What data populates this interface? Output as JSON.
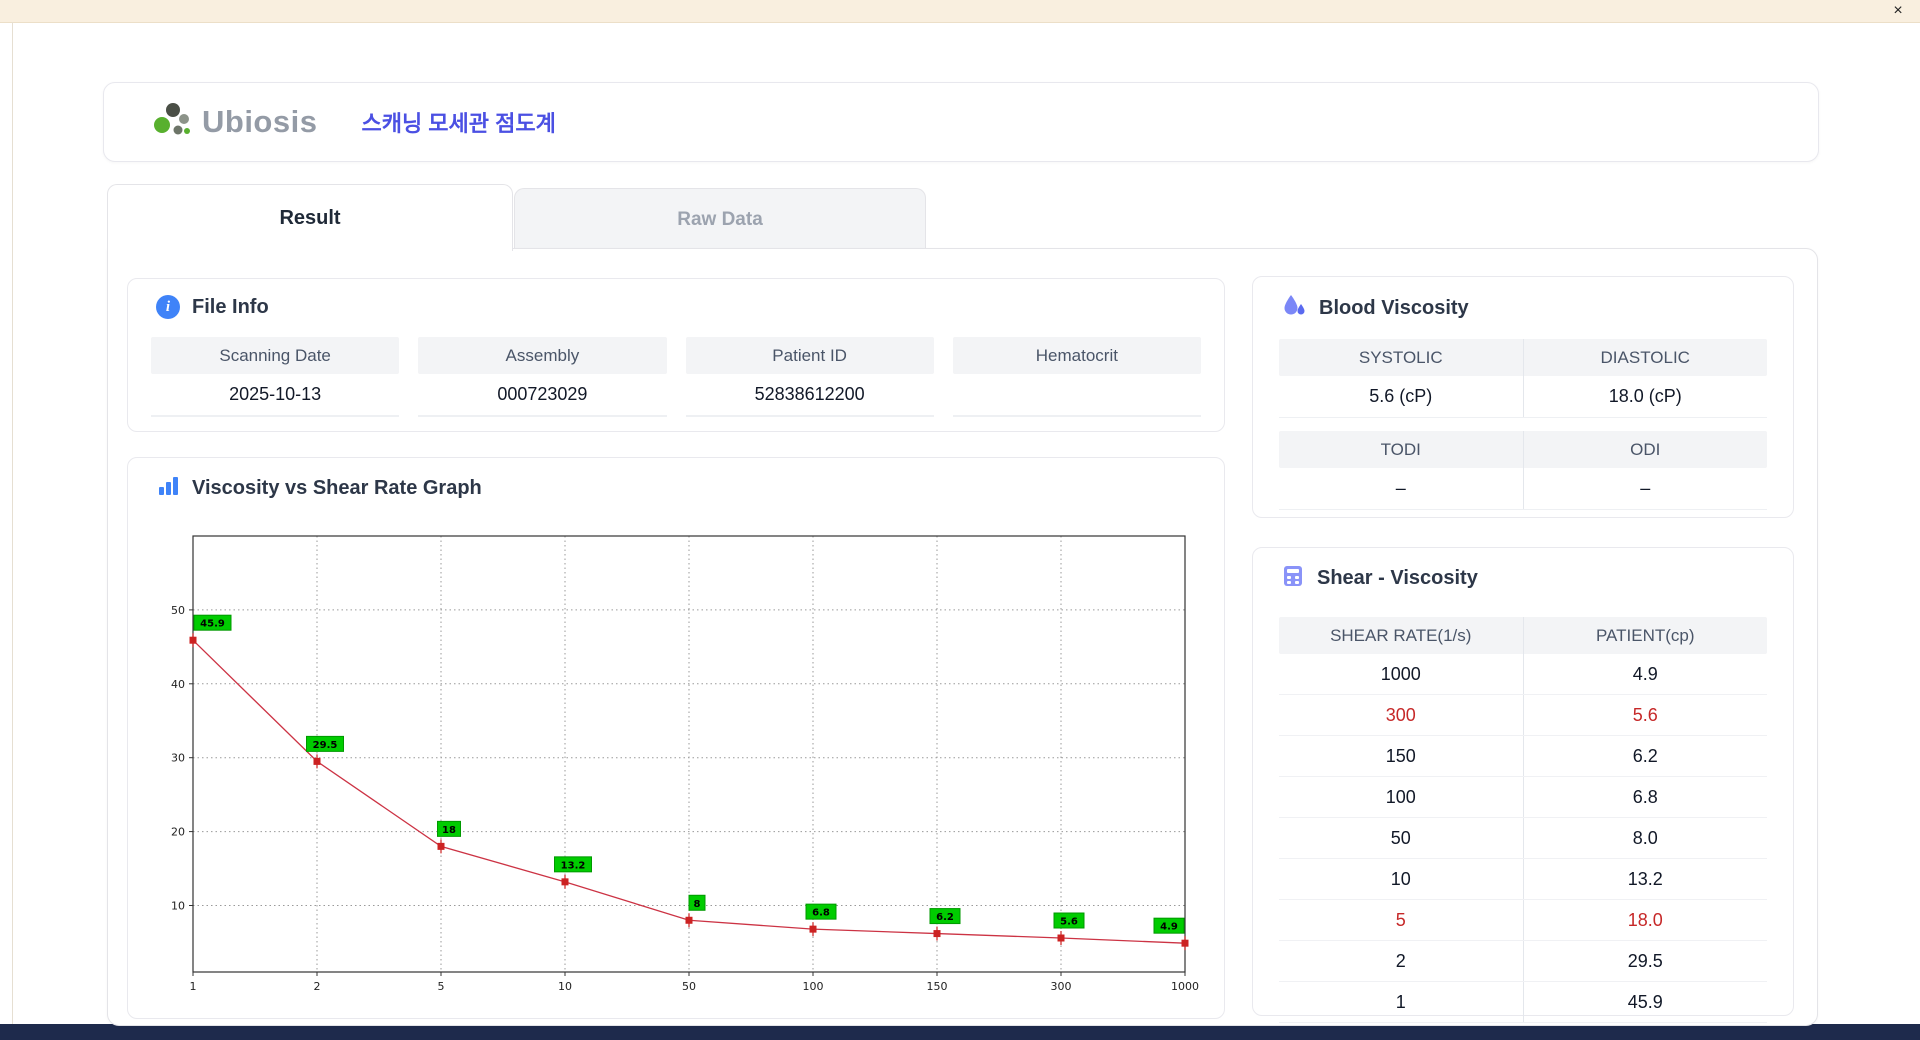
{
  "window": {
    "close_label": "×"
  },
  "header": {
    "logo_text": "Ubiosis",
    "app_title": "스캐닝 모세관 점도계"
  },
  "tabs": [
    {
      "label": "Result",
      "active": true
    },
    {
      "label": "Raw Data",
      "active": false
    }
  ],
  "file_info": {
    "title": "File Info",
    "fields": [
      {
        "label": "Scanning Date",
        "value": "2025-10-13"
      },
      {
        "label": "Assembly",
        "value": "000723029"
      },
      {
        "label": "Patient ID",
        "value": "52838612200"
      },
      {
        "label": "Hematocrit",
        "value": ""
      }
    ]
  },
  "blood_viscosity": {
    "title": "Blood Viscosity",
    "rows": [
      {
        "headers": [
          "SYSTOLIC",
          "DIASTOLIC"
        ],
        "values": [
          "5.6 (cP)",
          "18.0 (cP)"
        ]
      },
      {
        "headers": [
          "TODI",
          "ODI"
        ],
        "values": [
          "–",
          "–"
        ]
      }
    ]
  },
  "shear_viscosity": {
    "title": "Shear - Viscosity",
    "columns": [
      "SHEAR RATE(1/s)",
      "PATIENT(cp)"
    ],
    "rows": [
      {
        "shear": "1000",
        "patient": "4.9",
        "highlight": false
      },
      {
        "shear": "300",
        "patient": "5.6",
        "highlight": true
      },
      {
        "shear": "150",
        "patient": "6.2",
        "highlight": false
      },
      {
        "shear": "100",
        "patient": "6.8",
        "highlight": false
      },
      {
        "shear": "50",
        "patient": "8.0",
        "highlight": false
      },
      {
        "shear": "10",
        "patient": "13.2",
        "highlight": false
      },
      {
        "shear": "5",
        "patient": "18.0",
        "highlight": true
      },
      {
        "shear": "2",
        "patient": "29.5",
        "highlight": false
      },
      {
        "shear": "1",
        "patient": "45.9",
        "highlight": false
      }
    ]
  },
  "chart_data": {
    "type": "line",
    "title": "Viscosity vs Shear Rate Graph",
    "xlabel": "",
    "ylabel": "",
    "categories": [
      "1",
      "2",
      "5",
      "10",
      "50",
      "100",
      "150",
      "300",
      "1000"
    ],
    "values": [
      45.9,
      29.5,
      18,
      13.2,
      8,
      6.8,
      6.2,
      5.6,
      4.9
    ],
    "point_labels": [
      "45.9",
      "29.5",
      "18",
      "13.2",
      "8",
      "6.8",
      "6.2",
      "5.6",
      "4.9"
    ],
    "ylim": [
      1,
      60
    ],
    "yticks": [
      10,
      20,
      30,
      40,
      50
    ],
    "grid": true,
    "legend": "none",
    "line_color": "#cc3344",
    "marker_color": "#cc2222",
    "label_bg": "#00cc00",
    "label_border": "#009900"
  },
  "colors": {
    "accent_blue": "#3f83f8",
    "title_purple": "#4b50e3",
    "highlight_red": "#c62828",
    "titlebar_beige": "#f9efdf",
    "bottom_navy": "#1e2a4c",
    "table_header_gray": "#f3f4f6"
  }
}
